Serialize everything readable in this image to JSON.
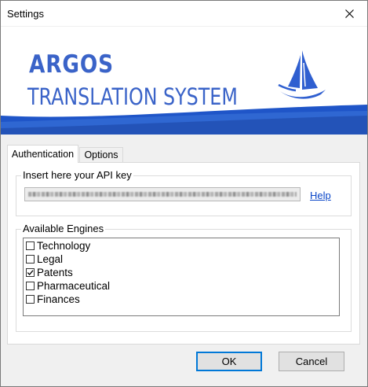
{
  "window": {
    "title": "Settings"
  },
  "brand": {
    "line1": "ARGOS",
    "line2": "TRANSLATION SYSTEM",
    "color": "#3a63c8",
    "logo_icon": "sailboat-logo-icon"
  },
  "tabs": [
    {
      "label": "Authentication",
      "active": true
    },
    {
      "label": "Options",
      "active": false
    }
  ],
  "auth": {
    "api_group_label": "Insert here your API key",
    "help_label": "Help",
    "engines_group_label": "Available Engines",
    "engines": [
      {
        "label": "Technology",
        "checked": false
      },
      {
        "label": "Legal",
        "checked": false
      },
      {
        "label": "Patents",
        "checked": true
      },
      {
        "label": "Pharmaceutical",
        "checked": false
      },
      {
        "label": "Finances",
        "checked": false
      }
    ]
  },
  "buttons": {
    "ok": "OK",
    "cancel": "Cancel"
  }
}
